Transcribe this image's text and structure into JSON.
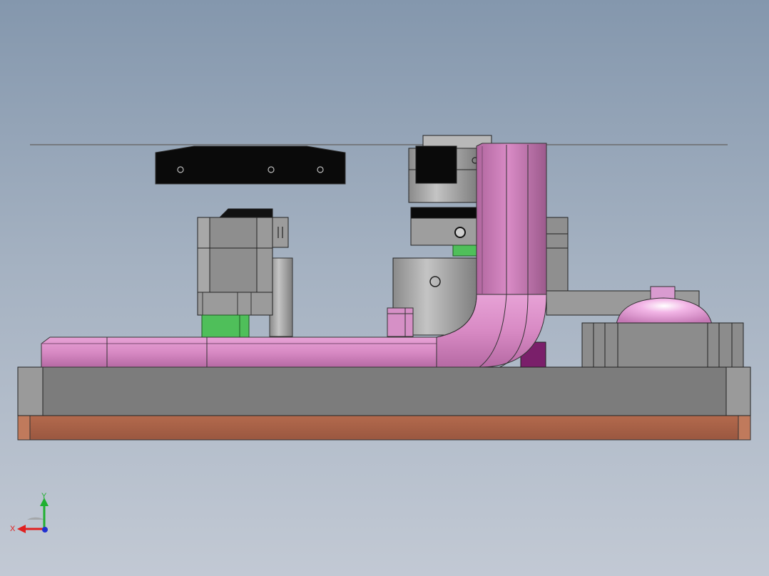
{
  "viewport": {
    "background_top": "#8497ad",
    "background_bottom": "#c2c9d4"
  },
  "colors": {
    "pink_part": "#d488c0",
    "pink_shadow": "#a8659a",
    "steel_gray": "#8c8c8c",
    "base_plate": "#7a7a7a",
    "copper_plate": "#a65c43",
    "green_part": "#4fbf5a",
    "black_part": "#0a0a0a",
    "magenta_block": "#7a1f6a"
  },
  "triad": {
    "x_label": "X",
    "y_label": "Y",
    "x_color": "#e02020",
    "y_color": "#20b030",
    "z_color": "#2030d0"
  }
}
